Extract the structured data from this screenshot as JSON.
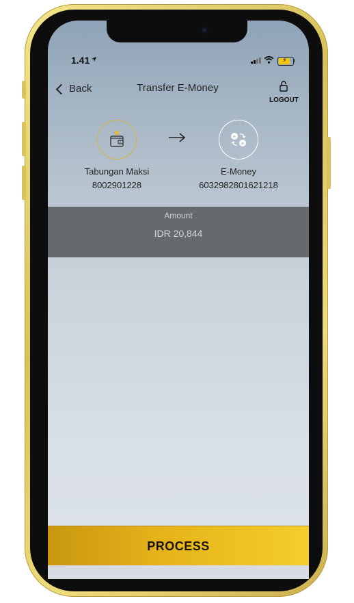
{
  "status_bar": {
    "time": "1.41"
  },
  "nav": {
    "back_label": "Back",
    "title": "Transfer E-Money",
    "logout_label": "LOGOUT"
  },
  "source_account": {
    "name": "Tabungan Maksi",
    "number": "8002901228",
    "icon": "wallet-icon"
  },
  "destination_account": {
    "name": "E-Money",
    "number": "6032982801621218",
    "icon": "emoney-exchange-icon"
  },
  "amount": {
    "label": "Amount",
    "value": "IDR 20,844"
  },
  "process_button": {
    "label": "PROCESS"
  },
  "colors": {
    "accent_gold": "#e6b41a",
    "amount_band": "#666a6d"
  }
}
